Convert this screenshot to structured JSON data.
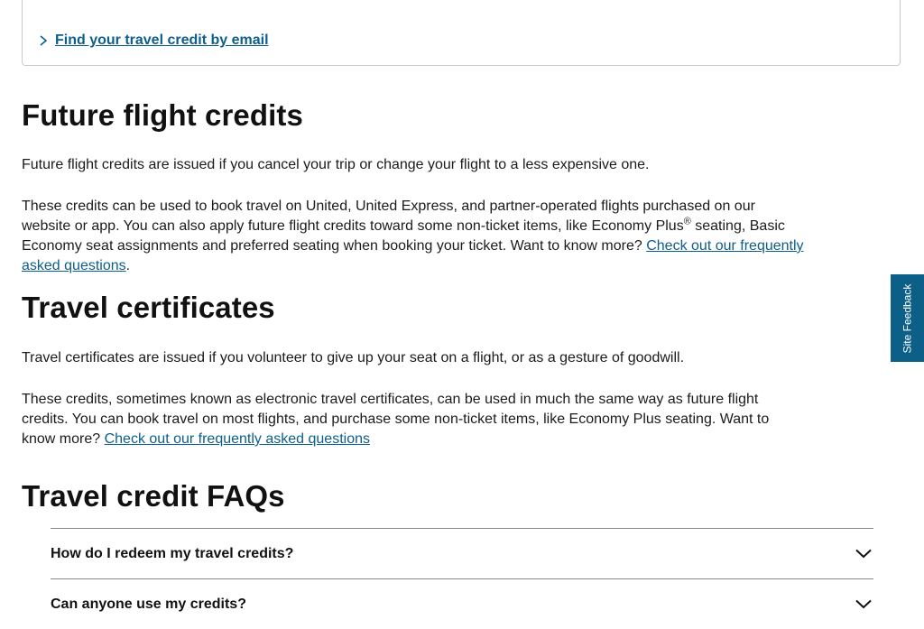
{
  "top_card": {
    "link_label": "Find your travel credit by email"
  },
  "sections": {
    "future": {
      "heading": "Future flight credits",
      "para1": "Future flight credits are issued if you cancel your trip or change your flight to a less expensive one.",
      "para2_part1": "These credits can be used to book travel on United, United Express, and partner-operated flights purchased on our website or app. You can also apply future flight credits toward some non-ticket items, like Economy Plus",
      "para2_sup": "®",
      "para2_part2": " seating, Basic Economy seat assignments and preferred seating when booking your ticket. Want to know more? ",
      "para2_link": "Check out our frequently asked questions",
      "para2_end": "."
    },
    "certificates": {
      "heading": "Travel certificates",
      "para1": "Travel certificates are issued if you volunteer to give up your seat on a flight, or as a gesture of goodwill.",
      "para2_text": "These credits, sometimes known as electronic travel certificates, can be used in much the same way as future flight credits. You can book travel on most flights, and purchase some non-ticket items, like Economy Plus seating. Want to know more? ",
      "para2_link": "Check out our frequently asked questions"
    },
    "faqs": {
      "heading": "Travel credit FAQs",
      "items": [
        "How do I redeem my travel credits?",
        "Can anyone use my credits?"
      ]
    }
  },
  "feedback_tab": {
    "label": "Site Feedback"
  },
  "colors": {
    "link": "#0c5e8c",
    "feedback_bg": "#0c5f86"
  }
}
